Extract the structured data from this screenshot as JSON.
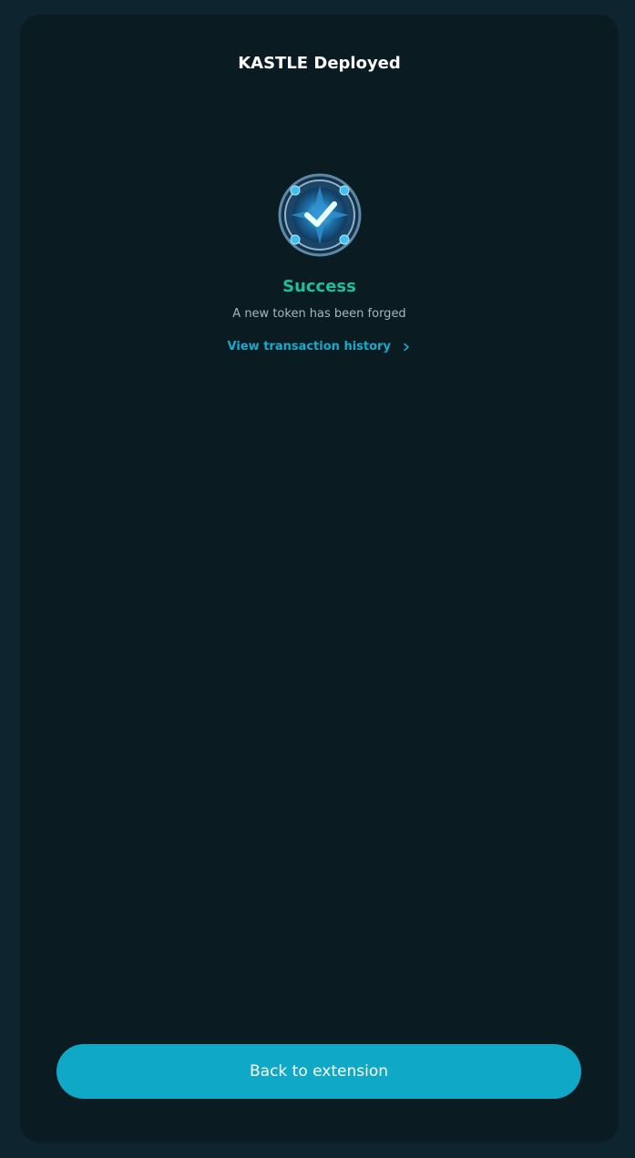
{
  "header": {
    "title": "KASTLE Deployed"
  },
  "result": {
    "status": "Success",
    "message": "A new token has been forged",
    "history_link": "View transaction history"
  },
  "footer": {
    "back_label": "Back to extension"
  },
  "colors": {
    "background": "#0a1b22",
    "success": "#1fbf9c",
    "accent": "#0fa9c7",
    "link": "#16aacb"
  },
  "icons": {
    "badge": "success-check-badge-icon",
    "chevron": "chevron-right-icon"
  }
}
